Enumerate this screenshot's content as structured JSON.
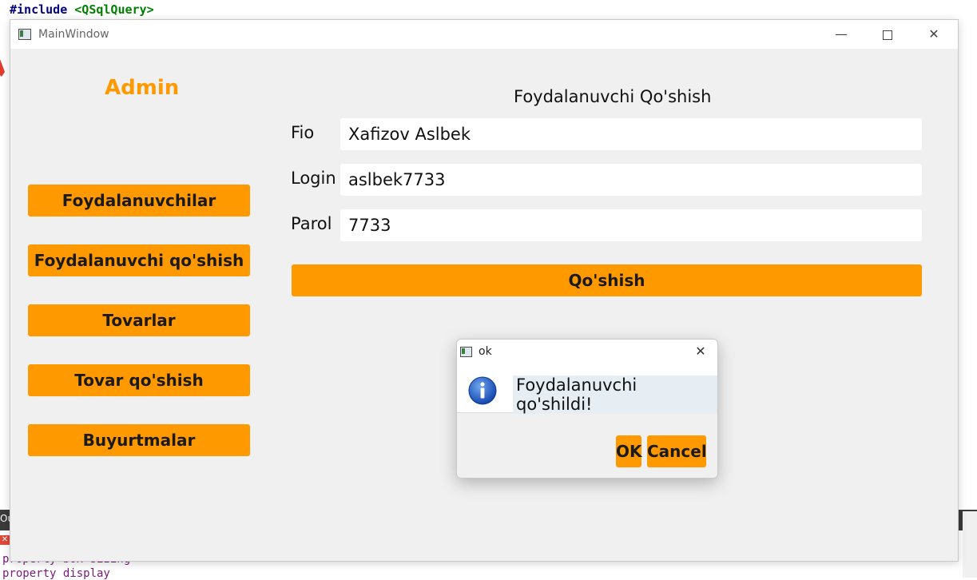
{
  "ide": {
    "code_keyword": "#include",
    "code_include": "<QSqlQuery>",
    "bottom_bar_text": "Ou",
    "bottom_lines": [
      "property box-sizing",
      "property display"
    ]
  },
  "window": {
    "title": "MainWindow",
    "minimize": "—",
    "close": "✕"
  },
  "sidebar": {
    "title": "Admin",
    "buttons": [
      {
        "label": "Foydalanuvchilar"
      },
      {
        "label": "Foydalanuvchi qo'shish"
      },
      {
        "label": "Tovarlar"
      },
      {
        "label": "Tovar qo'shish"
      },
      {
        "label": "Buyurtmalar"
      }
    ]
  },
  "form": {
    "title": "Foydalanuvchi Qo'shish",
    "fio_label": "Fio",
    "fio_value": "Xafizov Aslbek",
    "login_label": "Login",
    "login_value": "aslbek7733",
    "parol_label": "Parol",
    "parol_value": "7733",
    "submit_label": "Qo'shish"
  },
  "dialog": {
    "title": "ok",
    "close": "✕",
    "message": "Foydalanuvchi qo'shildi!",
    "ok_label": "OK",
    "cancel_label": "Cancel"
  },
  "colors": {
    "accent": "#ff9900",
    "window_bg": "#f0f0f0"
  }
}
